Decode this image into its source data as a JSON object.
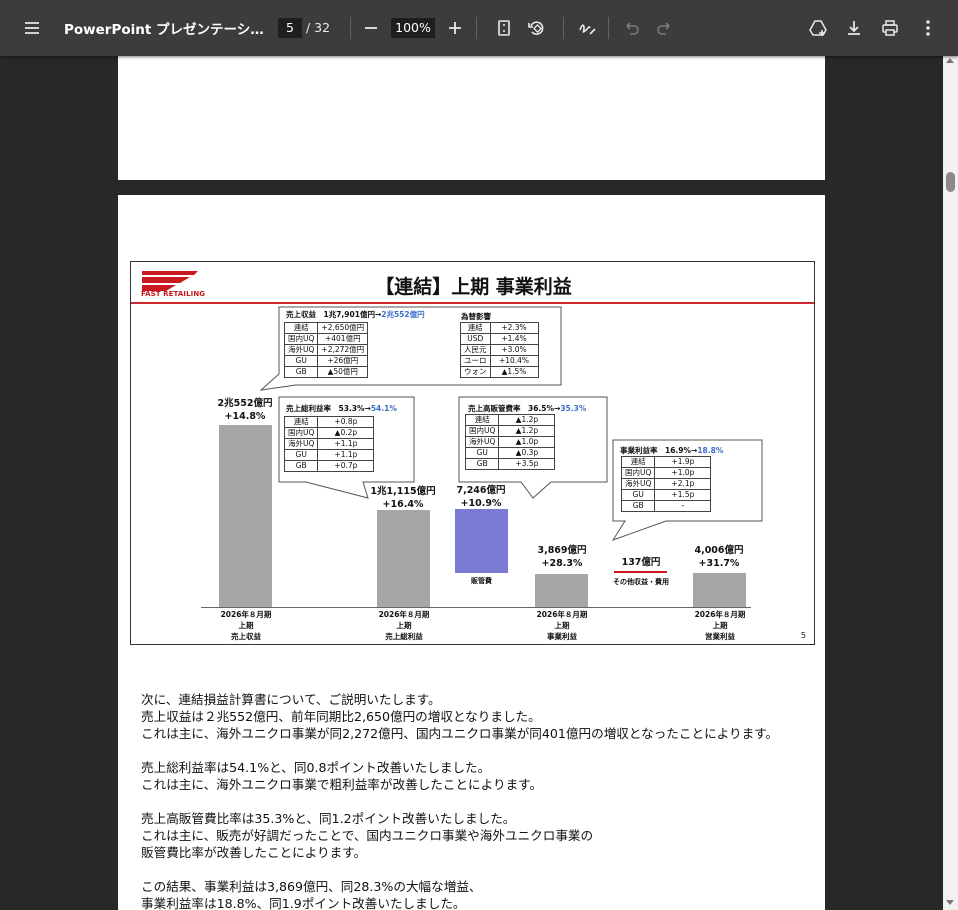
{
  "toolbar": {
    "menu_icon": "hamburger-menu-icon",
    "title": "PowerPoint プレゼンテーシ...",
    "page_current": "5",
    "page_total": "/ 32",
    "zoom": "100%"
  },
  "slide": {
    "title": "【連結】上期 事業利益",
    "logo_text": "FAST RETAILING",
    "page_number": "5",
    "bars": [
      {
        "id": "sales",
        "value_label": "2兆552億円",
        "change_label": "+14.8%",
        "axis": [
          "2026年８月期",
          "上期",
          "売上収益"
        ]
      },
      {
        "id": "gross",
        "value_label": "1兆1,115億円",
        "change_label": "+16.4%",
        "axis": [
          "2026年８月期",
          "上期",
          "売上総利益"
        ]
      },
      {
        "id": "sga",
        "value_label": "7,246億円",
        "change_label": "+10.9%",
        "inner": "販管費"
      },
      {
        "id": "bp",
        "value_label": "3,869億円",
        "change_label": "+28.3%",
        "axis": [
          "2026年８月期",
          "上期",
          "事業利益"
        ]
      },
      {
        "id": "other",
        "value_label": "137億円",
        "inner": "その他収益・費用"
      },
      {
        "id": "op",
        "value_label": "4,006億円",
        "change_label": "+31.7%",
        "axis": [
          "2026年８月期",
          "上期",
          "営業利益"
        ]
      }
    ],
    "box_sales": {
      "header": "売上収益　1兆7,901億円→",
      "header_blue": "2兆552億円",
      "rows": [
        [
          "連結",
          "+2,650億円"
        ],
        [
          "国内UQ",
          "+401億円"
        ],
        [
          "海外UQ",
          "+2,272億円"
        ],
        [
          "GU",
          "+26億円"
        ],
        [
          "GB",
          "▲50億円"
        ]
      ],
      "fx_header": "為替影響",
      "fx_rows": [
        [
          "連結",
          "+2.3%"
        ],
        [
          "USD",
          "+1.4%"
        ],
        [
          "人民元",
          "+3.0%"
        ],
        [
          "ユーロ",
          "+10.4%"
        ],
        [
          "ウォン",
          "▲1.5%"
        ]
      ]
    },
    "box_gross": {
      "header": "売上総利益率　53.3%→",
      "header_blue": "54.1%",
      "rows": [
        [
          "連結",
          "+0.8p"
        ],
        [
          "国内UQ",
          "▲0.2p"
        ],
        [
          "海外UQ",
          "+1.1p"
        ],
        [
          "GU",
          "+1.1p"
        ],
        [
          "GB",
          "+0.7p"
        ]
      ]
    },
    "box_sga": {
      "header": "売上高販管費率　36.5%→",
      "header_blue": "35.3%",
      "rows": [
        [
          "連結",
          "▲1.2p"
        ],
        [
          "国内UQ",
          "▲1.2p"
        ],
        [
          "海外UQ",
          "▲1.0p"
        ],
        [
          "GU",
          "▲0.3p"
        ],
        [
          "GB",
          "+3.5p"
        ]
      ]
    },
    "box_bp": {
      "header": "事業利益率　16.9%→",
      "header_blue": "18.8%",
      "rows": [
        [
          "連結",
          "+1.9p"
        ],
        [
          "国内UQ",
          "+1.0p"
        ],
        [
          "海外UQ",
          "+2.1p"
        ],
        [
          "GU",
          "+1.5p"
        ],
        [
          "GB",
          "-"
        ]
      ]
    }
  },
  "notes": [
    "次に、連結損益計算書について、ご説明いたします。",
    "売上収益は２兆552億円、前年同期比2,650億円の増収となりました。",
    "これは主に、海外ユニクロ事業が同2,272億円、国内ユニクロ事業が同401億円の増収となったことによります。",
    "",
    "売上総利益率は54.1%と、同0.8ポイント改善いたしました。",
    "これは主に、海外ユニクロ事業で粗利益率が改善したことによります。",
    "",
    "売上高販管費比率は35.3%と、同1.2ポイント改善いたしました。",
    "これは主に、販売が好調だったことで、国内ユニクロ事業や海外ユニクロ事業の",
    "販管費比率が改善したことによります。",
    "",
    "この結果、事業利益は3,869億円、同28.3%の大幅な増益、",
    "事業利益率は18.8%、同1.9ポイント改善いたしました。"
  ]
}
